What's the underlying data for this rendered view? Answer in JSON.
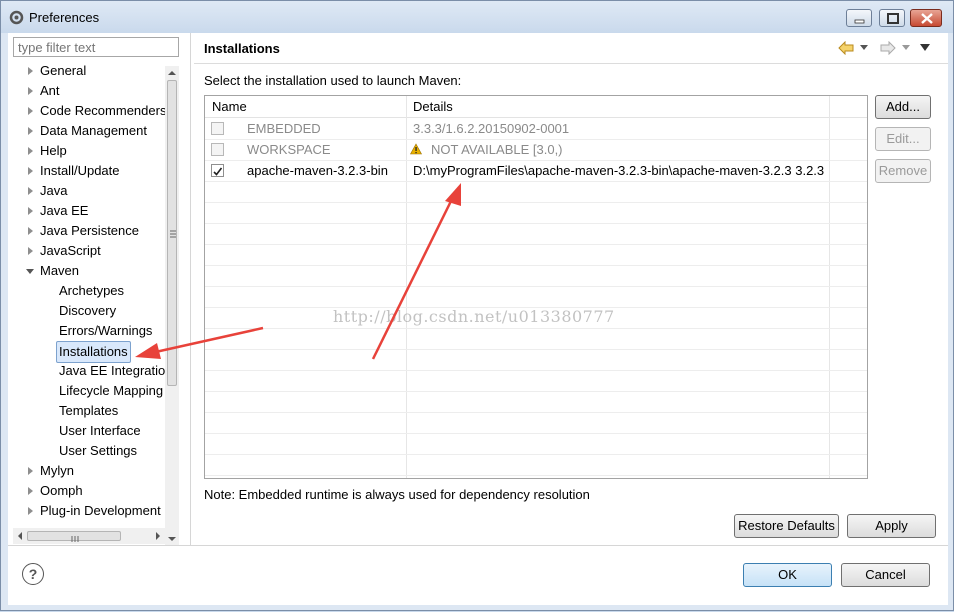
{
  "window": {
    "title": "Preferences"
  },
  "filter": {
    "placeholder": "type filter text"
  },
  "tree": {
    "items": [
      {
        "label": "General",
        "expander": "closed",
        "level": 0
      },
      {
        "label": "Ant",
        "expander": "closed",
        "level": 0
      },
      {
        "label": "Code Recommenders",
        "expander": "closed",
        "level": 0
      },
      {
        "label": "Data Management",
        "expander": "closed",
        "level": 0
      },
      {
        "label": "Help",
        "expander": "closed",
        "level": 0
      },
      {
        "label": "Install/Update",
        "expander": "closed",
        "level": 0
      },
      {
        "label": "Java",
        "expander": "closed",
        "level": 0
      },
      {
        "label": "Java EE",
        "expander": "closed",
        "level": 0
      },
      {
        "label": "Java Persistence",
        "expander": "closed",
        "level": 0
      },
      {
        "label": "JavaScript",
        "expander": "closed",
        "level": 0
      },
      {
        "label": "Maven",
        "expander": "open",
        "level": 0
      },
      {
        "label": "Archetypes",
        "expander": "none",
        "level": 1
      },
      {
        "label": "Discovery",
        "expander": "none",
        "level": 1
      },
      {
        "label": "Errors/Warnings",
        "expander": "none",
        "level": 1
      },
      {
        "label": "Installations",
        "expander": "none",
        "level": 1,
        "selected": true
      },
      {
        "label": "Java EE Integration",
        "expander": "none",
        "level": 1
      },
      {
        "label": "Lifecycle Mapping",
        "expander": "none",
        "level": 1
      },
      {
        "label": "Templates",
        "expander": "none",
        "level": 1
      },
      {
        "label": "User Interface",
        "expander": "none",
        "level": 1
      },
      {
        "label": "User Settings",
        "expander": "none",
        "level": 1
      },
      {
        "label": "Mylyn",
        "expander": "closed",
        "level": 0
      },
      {
        "label": "Oomph",
        "expander": "closed",
        "level": 0
      },
      {
        "label": "Plug-in Development",
        "expander": "closed",
        "level": 0
      }
    ]
  },
  "page": {
    "title": "Installations",
    "subtitle": "Select the installation used to launch Maven:",
    "note": "Note: Embedded runtime is always used for dependency resolution"
  },
  "table": {
    "columns": [
      "Name",
      "Details"
    ],
    "rows": [
      {
        "checked": false,
        "enabled": false,
        "name": "EMBEDDED",
        "details": "3.3.3/1.6.2.20150902-0001",
        "warning": false
      },
      {
        "checked": false,
        "enabled": false,
        "name": "WORKSPACE",
        "details": "NOT AVAILABLE [3.0,)",
        "warning": true
      },
      {
        "checked": true,
        "enabled": true,
        "name": "apache-maven-3.2.3-bin",
        "details": "D:\\myProgramFiles\\apache-maven-3.2.3-bin\\apache-maven-3.2.3 3.2.3",
        "warning": false
      }
    ]
  },
  "buttons": {
    "add": "Add...",
    "edit": "Edit...",
    "remove": "Remove",
    "restore_defaults": "Restore Defaults",
    "apply": "Apply",
    "ok": "OK",
    "cancel": "Cancel"
  },
  "watermark": "http://blog.csdn.net/u013380777",
  "colors": {
    "annotation_arrow": "#e8423a",
    "selection": "#d9e8fb",
    "warning": "#e8b000"
  }
}
